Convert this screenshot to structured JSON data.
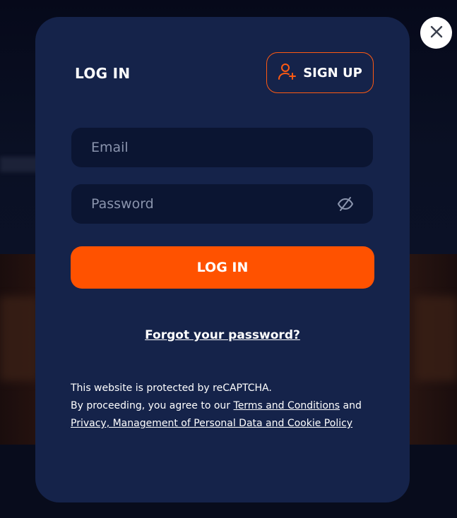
{
  "modal": {
    "title": "LOG IN",
    "signup_label": "SIGN UP",
    "email_placeholder": "Email",
    "password_placeholder": "Password",
    "login_label": "LOG IN",
    "forgot_label": "Forgot your password?",
    "legal": {
      "line1": "This website is protected by reCAPTCHA.",
      "line2_prefix": "By proceeding, you agree to our ",
      "terms_link": "Terms and Conditions",
      "line2_suffix": " and",
      "privacy_link": "Privacy, Management of Personal Data and Cookie Policy"
    }
  },
  "icons": {
    "signup": "user-plus-icon",
    "password_toggle": "eye-off-icon",
    "close": "close-icon"
  },
  "colors": {
    "accent": "#ff5200",
    "modal_bg": "#15234a",
    "field_bg": "#0b1532"
  }
}
